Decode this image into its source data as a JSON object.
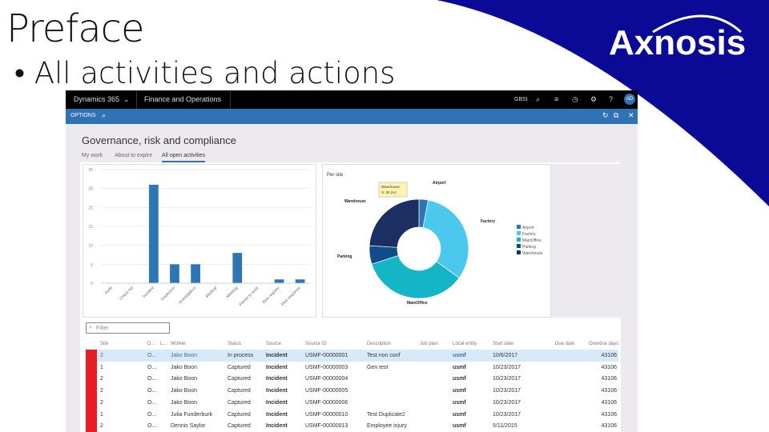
{
  "slide": {
    "title": "Preface",
    "bullet": "• All activities and actions",
    "logo_text": "Axnosis"
  },
  "colors": {
    "logo_bg": "#0a0a96",
    "topbar": "#000000",
    "optbar": "#2f72b6",
    "bar": "#2e75b6",
    "stripe": "#e81c23"
  },
  "app": {
    "product": "Dynamics 365",
    "product_chevron": "⌄",
    "module": "Finance and Operations",
    "company": "GBSI",
    "user_initials": "AD",
    "options_label": "OPTIONS"
  },
  "page": {
    "title": "Governance, risk and compliance",
    "tabs": [
      {
        "label": "My work"
      },
      {
        "label": "About to expire"
      },
      {
        "label": "All open activities",
        "active": true
      }
    ]
  },
  "chart_data": [
    {
      "type": "bar",
      "title": "",
      "categories": [
        "Audit",
        "Check list",
        "Incident",
        "Inspection",
        "Investigation",
        "Medical",
        "Meeting",
        "Permit to work",
        "Risk register",
        "Risk response"
      ],
      "values": [
        0,
        0,
        26,
        5,
        5,
        0,
        8,
        0,
        1,
        1
      ],
      "ylim": [
        0,
        30
      ],
      "yticks": [
        "0",
        "5",
        "10",
        "15",
        "20",
        "25",
        "30"
      ],
      "grid": true
    },
    {
      "type": "pie",
      "title": "Per site",
      "categories": [
        "Airport",
        "Factory",
        "MainOffice",
        "Parking",
        "Warehouse"
      ],
      "values": [
        3,
        32,
        35,
        6,
        24
      ],
      "colors": [
        "#2e75b6",
        "#4cc8ee",
        "#13b5c6",
        "#0f4c8c",
        "#1b2f63"
      ],
      "legend": "right",
      "tooltip": {
        "title": "Warehouse",
        "value": "S: 25 (%)"
      }
    }
  ],
  "filter": {
    "placeholder": "Filter"
  },
  "table": {
    "headers": {
      "site": "Site",
      "d": "D...",
      "l": "L...",
      "worker": "Worker",
      "status": "Status",
      "source": "Source",
      "source_id": "Source ID",
      "description": "Description",
      "job_plan": "Job plan",
      "entity": "Local entity",
      "start": "Start date",
      "due": "Due date",
      "overdue": "Overdue days"
    },
    "rows": [
      {
        "site": "2",
        "d": "O...",
        "worker": "Jako Boon",
        "status": "In process",
        "source": "Incident",
        "source_id": "USMF-00000001",
        "description": "Test non conf",
        "entity": "usmf",
        "start": "10/6/2017",
        "overdue": "43106"
      },
      {
        "site": "1",
        "d": "O...",
        "worker": "Jako Boon",
        "status": "Captured",
        "source": "Incident",
        "source_id": "USMF-00000003",
        "description": "Gen test",
        "entity": "usmf",
        "start": "10/23/2017",
        "overdue": "43106"
      },
      {
        "site": "2",
        "d": "O...",
        "worker": "Jako Boon",
        "status": "Captured",
        "source": "Incident",
        "source_id": "USMF-00000004",
        "description": "",
        "entity": "usmf",
        "start": "10/23/2017",
        "overdue": "43106"
      },
      {
        "site": "2",
        "d": "O...",
        "worker": "Jako Boon",
        "status": "Captured",
        "source": "Incident",
        "source_id": "USMF-00000005",
        "description": "",
        "entity": "usmf",
        "start": "10/23/2017",
        "overdue": "43106"
      },
      {
        "site": "2",
        "d": "O...",
        "worker": "Jako Boon",
        "status": "Captured",
        "source": "Incident",
        "source_id": "USMF-00000006",
        "description": "",
        "entity": "usmf",
        "start": "10/23/2017",
        "overdue": "43106"
      },
      {
        "site": "1",
        "d": "O...",
        "worker": "Julia Funderburk",
        "status": "Captured",
        "source": "Incident",
        "source_id": "USMF-00000010",
        "description": "Test Duplicate2",
        "entity": "usmf",
        "start": "10/23/2017",
        "overdue": "43106"
      },
      {
        "site": "2",
        "d": "O...",
        "worker": "Dennis Saylor",
        "status": "Captured",
        "source": "Incident",
        "source_id": "USMF-00000013",
        "description": "Employee injury",
        "entity": "usmf",
        "start": "5/11/2015",
        "overdue": "43106"
      }
    ]
  }
}
